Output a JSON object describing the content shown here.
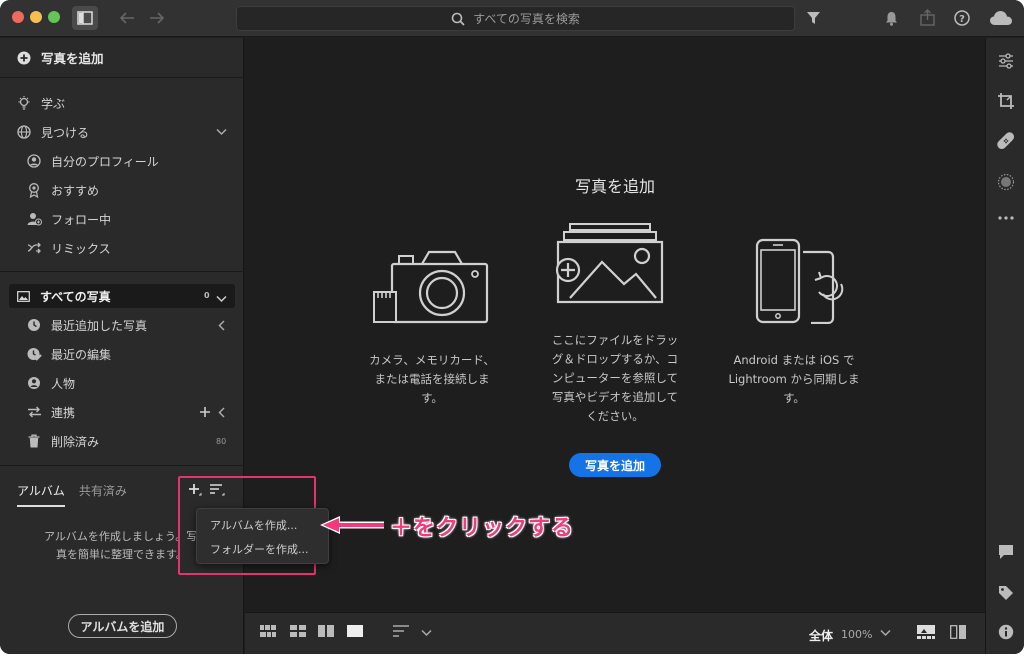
{
  "titlebar": {
    "search_placeholder": "すべての写真を検索"
  },
  "left": {
    "add_photo_label": "写真を追加",
    "learn": "学ぶ",
    "discover": "見つける",
    "discover_items": [
      "自分のプロフィール",
      "おすすめ",
      "フォロー中",
      "リミックス"
    ],
    "all_photos": "すべての写真",
    "all_photos_count": "0",
    "library_items": [
      "最近追加した写真",
      "最近の編集",
      "人物",
      "連携",
      "削除済み"
    ],
    "deleted_count": "80",
    "tabs": {
      "album": "アルバム",
      "shared": "共有済み"
    },
    "album_message_1": "アルバムを作成しましょう。写",
    "album_message_2": "真を簡単に整理できます。",
    "add_album_button": "アルバムを追加"
  },
  "menu": {
    "create_album": "アルバムを作成...",
    "create_folder": "フォルダーを作成..."
  },
  "annotation": {
    "text": "＋をクリックする",
    "color": "#f23a7c"
  },
  "main": {
    "title": "写真を追加",
    "col1": [
      "カメラ、メモリカード、",
      "または電話を接続しま",
      "す。"
    ],
    "col2": [
      "ここにファイルをドラッ",
      "グ＆ドロップするか、コ",
      "ンピューターを参照して",
      "写真やビデオを追加して",
      "ください。"
    ],
    "col3": [
      "Android または iOS で",
      "Lightroom から同期しま",
      "す。"
    ],
    "add_button": "写真を追加",
    "accent_color": "#1473e6"
  },
  "bottom": {
    "fit_label": "全体",
    "zoom_value": "100%"
  }
}
